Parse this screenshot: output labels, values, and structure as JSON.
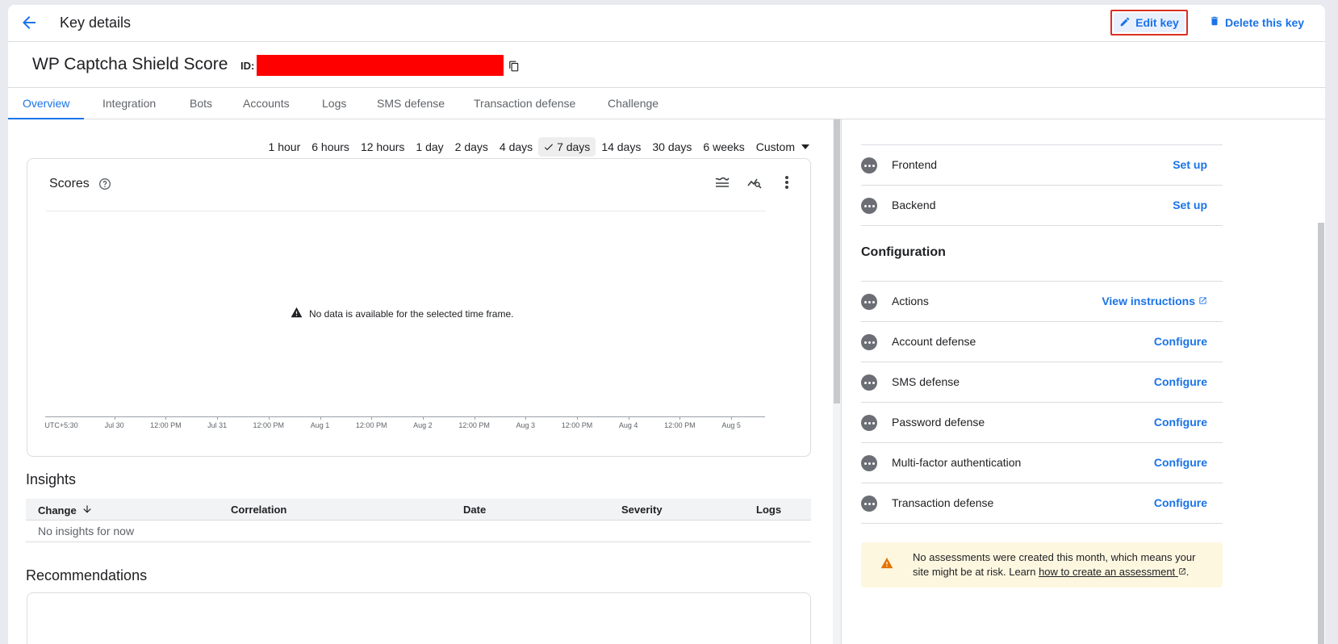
{
  "header": {
    "title": "Key details",
    "edit_label": "Edit key",
    "delete_label": "Delete this key"
  },
  "key": {
    "name": "WP Captcha Shield Score",
    "id_label": "ID:"
  },
  "tabs": [
    {
      "label": "Overview"
    },
    {
      "label": "Integration"
    },
    {
      "label": "Bots"
    },
    {
      "label": "Accounts"
    },
    {
      "label": "Logs"
    },
    {
      "label": "SMS defense"
    },
    {
      "label": "Transaction defense"
    },
    {
      "label": "Challenge"
    }
  ],
  "time_range": {
    "options": [
      "1 hour",
      "6 hours",
      "12 hours",
      "1 day",
      "2 days",
      "4 days",
      "7 days",
      "14 days",
      "30 days",
      "6 weeks"
    ],
    "selected": "7 days",
    "custom_label": "Custom"
  },
  "scores_card": {
    "title": "Scores",
    "no_data": "No data is available for the selected time frame.",
    "x_tick_labels": [
      "UTC+5:30",
      "Jul 30",
      "12:00 PM",
      "Jul 31",
      "12:00 PM",
      "Aug 1",
      "12:00 PM",
      "Aug 2",
      "12:00 PM",
      "Aug 3",
      "12:00 PM",
      "Aug 4",
      "12:00 PM",
      "Aug 5"
    ]
  },
  "insights": {
    "title": "Insights",
    "columns": {
      "change": "Change",
      "correlation": "Correlation",
      "date": "Date",
      "severity": "Severity",
      "logs": "Logs"
    },
    "empty": "No insights for now"
  },
  "recommendations": {
    "title": "Recommendations"
  },
  "integration": {
    "items": [
      {
        "label": "Frontend",
        "action": "Set up"
      },
      {
        "label": "Backend",
        "action": "Set up"
      }
    ]
  },
  "configuration": {
    "title": "Configuration",
    "items": [
      {
        "label": "Actions",
        "action": "View instructions"
      },
      {
        "label": "Account defense",
        "action": "Configure"
      },
      {
        "label": "SMS defense",
        "action": "Configure"
      },
      {
        "label": "Password defense",
        "action": "Configure"
      },
      {
        "label": "Multi-factor authentication",
        "action": "Configure"
      },
      {
        "label": "Transaction defense",
        "action": "Configure"
      }
    ]
  },
  "warning": {
    "text_before": "No assessments were created this month, which means your site might be at risk. Learn ",
    "link": "how to create an assessment",
    "text_after": "."
  },
  "colors": {
    "accent": "#1a73e8",
    "highlight_border": "#d93025",
    "redaction": "#ff0000",
    "warning_bg": "#fef7e0",
    "warning_icon": "#e37400"
  }
}
